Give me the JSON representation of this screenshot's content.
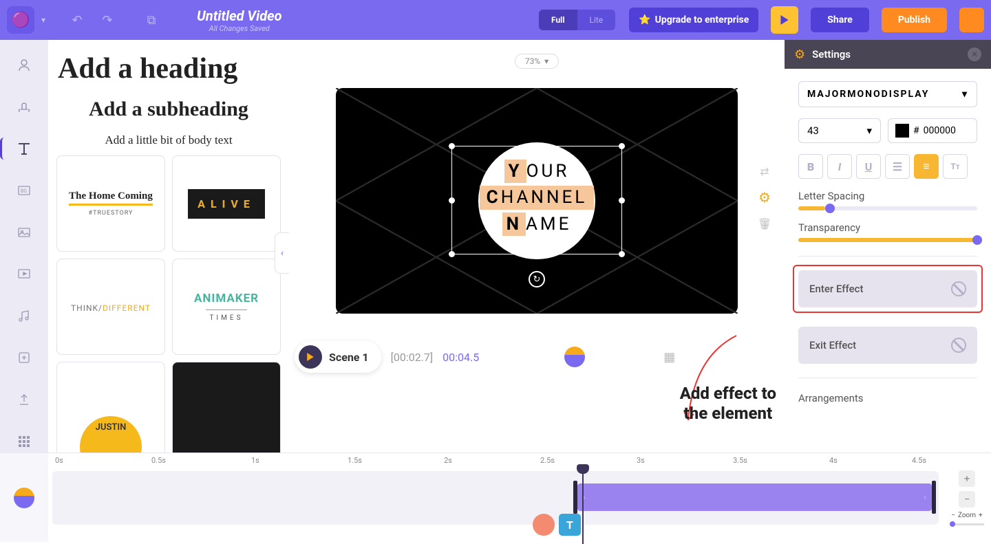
{
  "topbar": {
    "title": "Untitled Video",
    "saved": "All Changes Saved",
    "mode_full": "Full",
    "mode_lite": "Lite",
    "upgrade": "Upgrade to enterprise",
    "share": "Share",
    "publish": "Publish"
  },
  "library": {
    "heading": "Add a heading",
    "subheading": "Add a subheading",
    "body": "Add a little bit of body text",
    "cards": {
      "c1_main": "The Home Coming",
      "c1_sub": "#TRUESTORY",
      "c2": "ALIVE",
      "c3_a": "THINK/",
      "c3_b": "DIFFERENT",
      "c4_top": "ANIMAKER",
      "c4_bot": "TIMES",
      "c5": "JUSTIN"
    }
  },
  "canvas": {
    "zoom": "73%",
    "text_l1_first": "Y",
    "text_l1_rest": "OUR",
    "text_l2_first": "C",
    "text_l2_rest": "HANNEL",
    "text_l3_first": "N",
    "text_l3_rest": "AME"
  },
  "scene": {
    "name": "Scene 1",
    "current": "[00:02.7]",
    "total": "00:04.5"
  },
  "annotation": {
    "l1": "Add effect to",
    "l2": "the element"
  },
  "settings": {
    "title": "Settings",
    "font": "MAJORMONODISPLAY",
    "size": "43",
    "color_hash": "#",
    "color": "000000",
    "letter_spacing": "Letter Spacing",
    "transparency": "Transparency",
    "enter_effect": "Enter Effect",
    "exit_effect": "Exit Effect",
    "arrangements": "Arrangements",
    "letter_spacing_pct": 15,
    "transparency_pct": 100
  },
  "timeline": {
    "marks": [
      "0s",
      "0.5s",
      "1s",
      "1.5s",
      "2s",
      "2.5s",
      "3s",
      "3.5s",
      "4s",
      "4.5s"
    ],
    "zoom_minus": "−",
    "zoom_label": "Zoom",
    "zoom_plus": "+",
    "chip_t": "T"
  },
  "colors": {
    "accent_purple": "#7a6af0",
    "accent_orange": "#ff8a1f",
    "accent_yellow": "#f7b733"
  }
}
